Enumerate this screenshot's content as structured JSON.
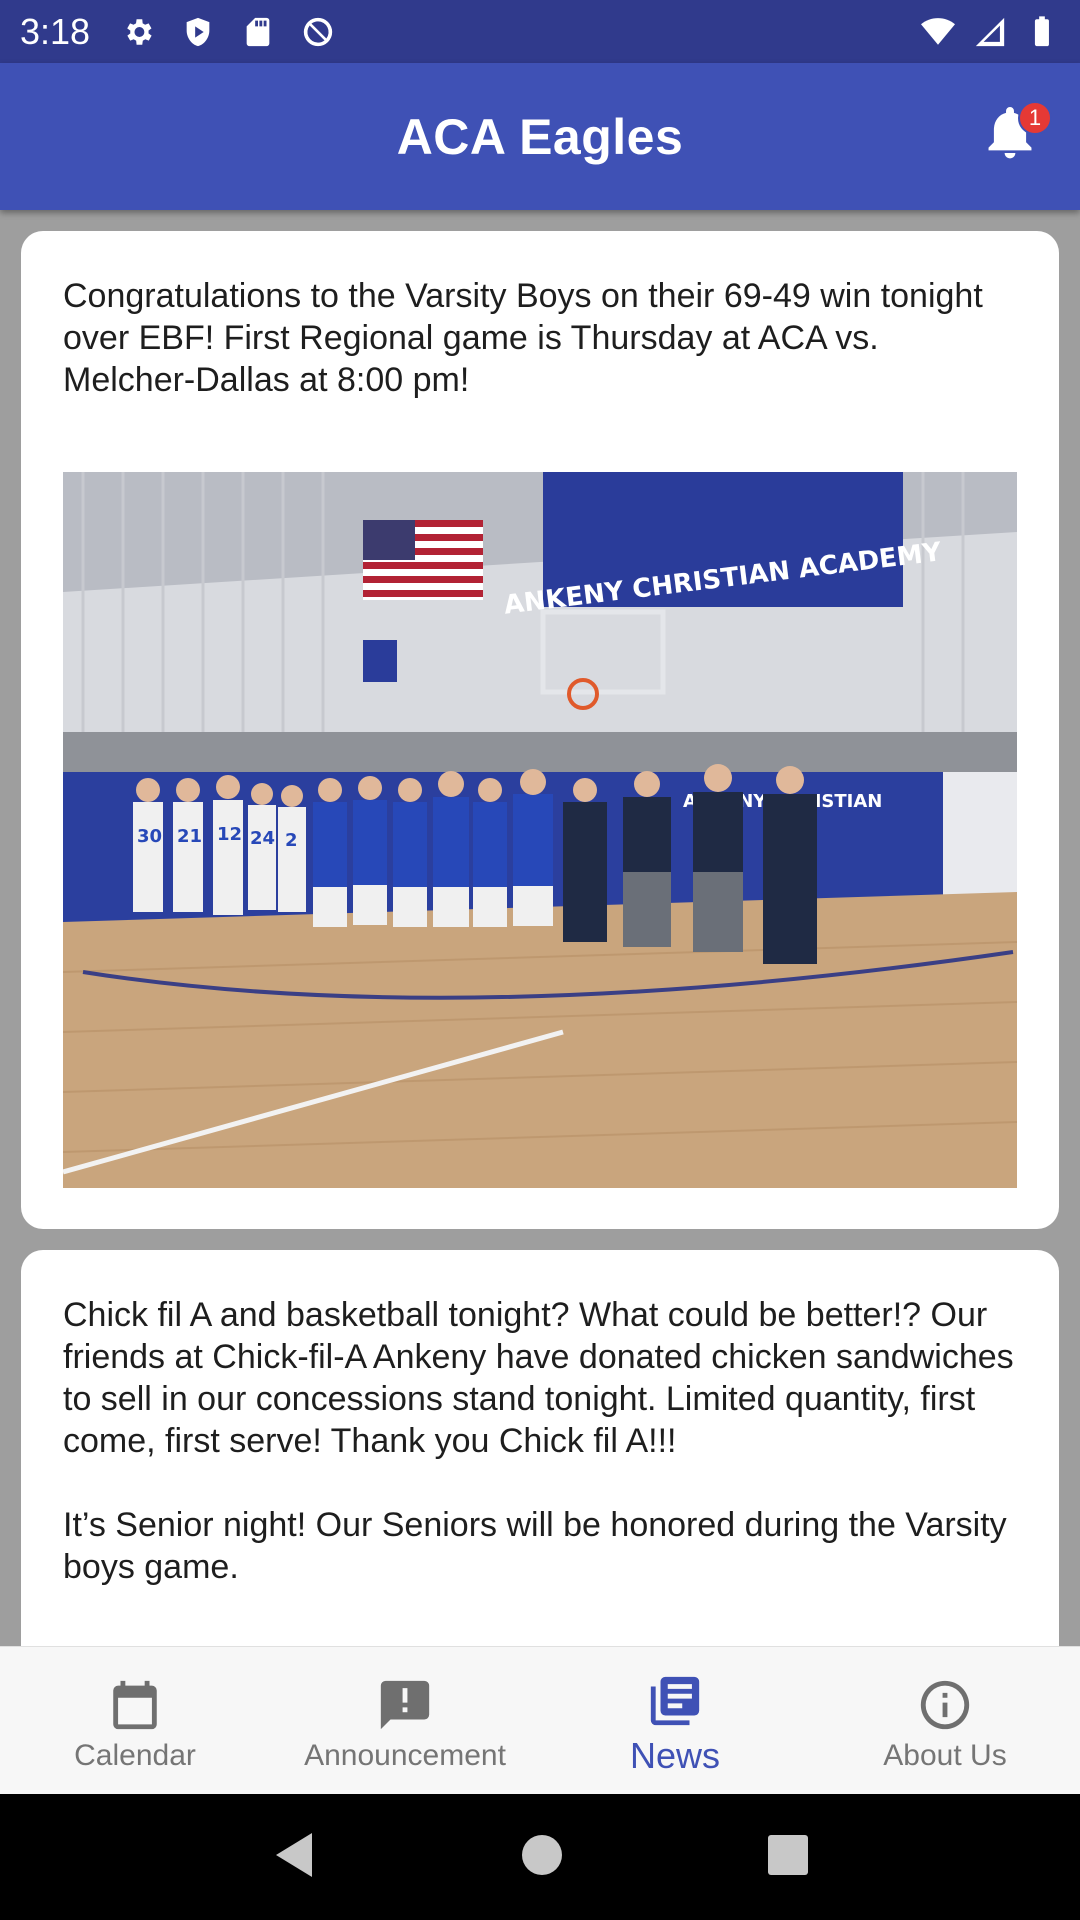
{
  "status_bar": {
    "time": "3:18",
    "left_icons": [
      "gear-icon",
      "shield-play-icon",
      "sd-card-icon",
      "at-icon"
    ],
    "right_icons": [
      "wifi-icon",
      "signal-icon",
      "battery-icon"
    ]
  },
  "app_bar": {
    "title": "ACA Eagles",
    "notification_count": "1",
    "accent_color": "#3f51b5",
    "status_color": "#303a8c",
    "badge_color": "#e53935"
  },
  "feed": {
    "posts": [
      {
        "text": "Congratulations to the Varsity Boys on their 69-49 win tonight over EBF! First Regional game is Thursday at ACA vs. Melcher-Dallas at 8:00 pm!",
        "banner_text": "ANKENY CHRISTIAN ACADEMY",
        "wall_text": "ANKENY CHRISTIAN",
        "jerseys": [
          "30",
          "21",
          "12",
          "24",
          "2"
        ]
      },
      {
        "text": "Chick fil A and basketball tonight? What could be better!? Our friends at Chick-fil-A Ankeny have donated chicken sandwiches to sell in our concessions stand tonight. Limited quantity, first come, first serve! Thank you Chick fil A!!!\n\nIt’s Senior night! Our Seniors will be honored during the Varsity boys game."
      }
    ]
  },
  "bottom_nav": {
    "items": [
      {
        "label": "Calendar",
        "icon": "calendar-icon",
        "active": false
      },
      {
        "label": "Announcement",
        "icon": "announcement-icon",
        "active": false
      },
      {
        "label": "News",
        "icon": "news-icon",
        "active": true
      },
      {
        "label": "About Us",
        "icon": "info-icon",
        "active": false
      }
    ]
  },
  "system_nav": {
    "buttons": [
      "back-icon",
      "home-icon",
      "recents-icon"
    ]
  }
}
